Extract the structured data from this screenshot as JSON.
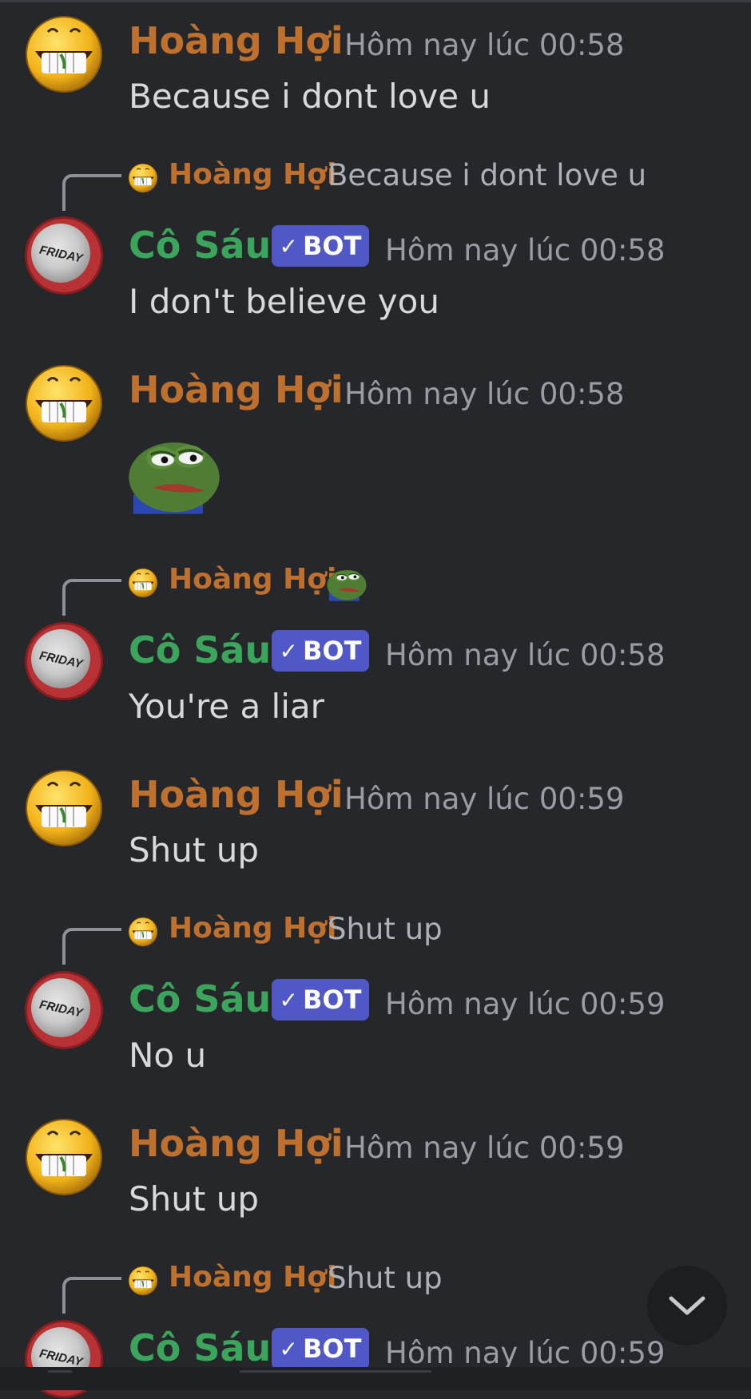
{
  "theme": {
    "background": "#26272b",
    "user_color": "#c0702d",
    "bot_color": "#3ba55c",
    "bot_tag_color": "#5058c8",
    "time_color": "#9a9ca3"
  },
  "messages": [
    {
      "author": "Hoàng Hợi",
      "time": "Hôm nay lúc 00:58",
      "text": "Because i dont love u"
    },
    {
      "reply_to": "Hoàng Hợi",
      "reply_text": "Because i dont love u",
      "author": "Cô Sáu",
      "tag": "BOT",
      "time": "Hôm nay lúc 00:58",
      "text": "I don't believe you"
    },
    {
      "author": "Hoàng Hợi",
      "time": "Hôm nay lúc 00:58",
      "emoji": "pepe-frog-emoji"
    },
    {
      "reply_to": "Hoàng Hợi",
      "reply_emoji": "pepe-frog-emoji",
      "author": "Cô Sáu",
      "tag": "BOT",
      "time": "Hôm nay lúc 00:58",
      "text": "You're a liar"
    },
    {
      "author": "Hoàng Hợi",
      "time": "Hôm nay lúc 00:59",
      "text": "Shut up"
    },
    {
      "reply_to": "Hoàng Hợi",
      "reply_text": "Shut up",
      "author": "Cô Sáu",
      "tag": "BOT",
      "time": "Hôm nay lúc 00:59",
      "text": "No u"
    },
    {
      "author": "Hoàng Hợi",
      "time": "Hôm nay lúc 00:59",
      "text": "Shut up"
    },
    {
      "reply_to": "Hoàng Hợi",
      "reply_text": "Shut up",
      "author": "Cô Sáu",
      "tag": "BOT",
      "time": "Hôm nay lúc 00:59"
    }
  ],
  "icons": {
    "scroll_down": "chevron-down-icon",
    "bot_verified": "checkmark-icon",
    "bot_avatar_text": "FRIDAY"
  }
}
